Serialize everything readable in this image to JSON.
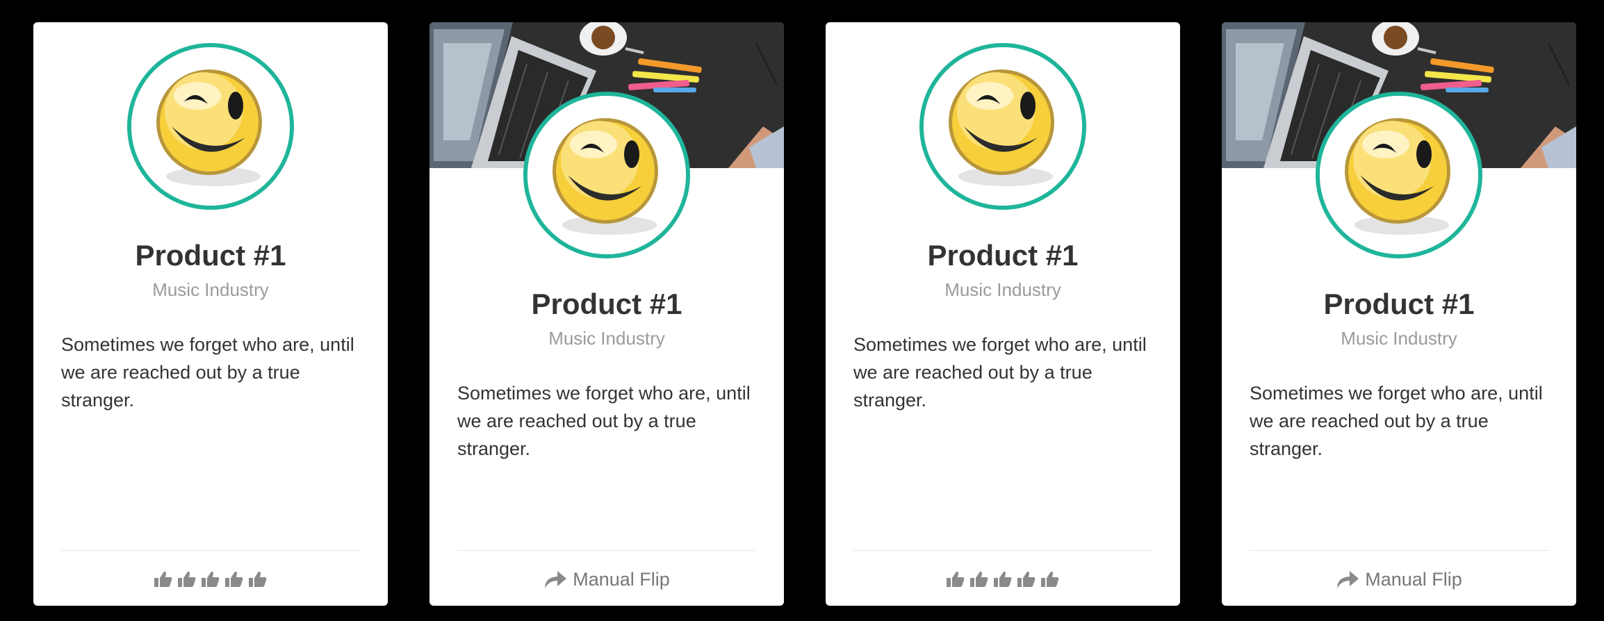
{
  "cards": [
    {
      "variant": "plain",
      "cover_image": "",
      "avatar_icon": "winking-smiley-icon",
      "title": "Product #1",
      "subtitle": "Music Industry",
      "description": "Sometimes we forget who are, until we are reached out by a true stranger.",
      "footer": {
        "type": "rating",
        "icon": "thumbs-up-icon",
        "count": 5
      }
    },
    {
      "variant": "covered",
      "cover_image": "desk-laptop-coffee-cover",
      "avatar_icon": "winking-smiley-icon",
      "title": "Product #1",
      "subtitle": "Music Industry",
      "description": "Sometimes we forget who are, until we are reached out by a true stranger.",
      "footer": {
        "type": "button",
        "icon": "share-arrow-icon",
        "label": "Manual Flip"
      }
    },
    {
      "variant": "plain",
      "cover_image": "",
      "avatar_icon": "winking-smiley-icon",
      "title": "Product #1",
      "subtitle": "Music Industry",
      "description": "Sometimes we forget who are, until we are reached out by a true stranger.",
      "footer": {
        "type": "rating",
        "icon": "thumbs-up-icon",
        "count": 5
      }
    },
    {
      "variant": "covered",
      "cover_image": "desk-laptop-coffee-cover",
      "avatar_icon": "winking-smiley-icon",
      "title": "Product #1",
      "subtitle": "Music Industry",
      "description": "Sometimes we forget who are, until we are reached out by a true stranger.",
      "footer": {
        "type": "button",
        "icon": "share-arrow-icon",
        "label": "Manual Flip"
      }
    }
  ],
  "colors": {
    "background": "#000000",
    "card": "#ffffff",
    "avatar_ring": "#1fb59a",
    "title": "#333333",
    "subtitle": "#9a9a9a",
    "icon": "#8a8a8a"
  }
}
